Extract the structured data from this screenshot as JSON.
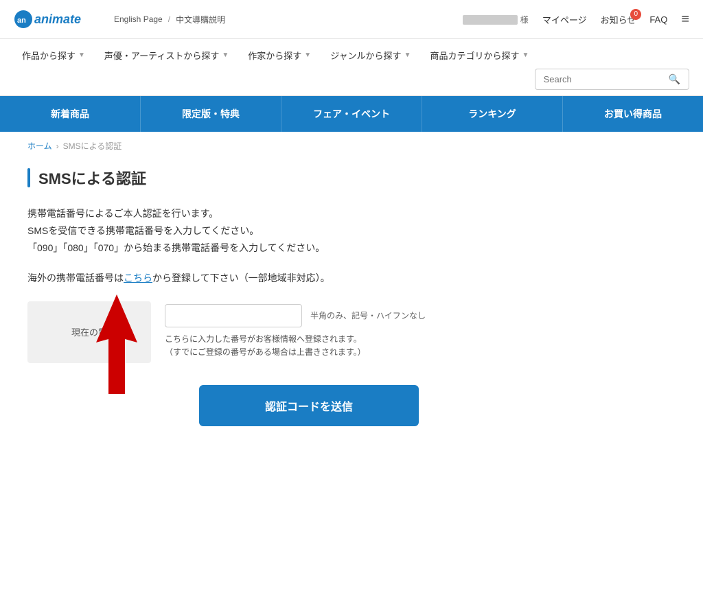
{
  "header": {
    "logo_alt": "animate",
    "english_page": "English Page",
    "separator": "/",
    "chinese_guide": "中文導購説明",
    "username": "様",
    "mypage": "マイページ",
    "notice": "お知らせ",
    "notice_count": "0",
    "faq": "FAQ",
    "menu_icon": "≡"
  },
  "nav": {
    "items": [
      {
        "label": "作品から探す",
        "has_dropdown": true
      },
      {
        "label": "声優・アーティストから探す",
        "has_dropdown": true
      },
      {
        "label": "作家から探す",
        "has_dropdown": true
      },
      {
        "label": "ジャンルから探す",
        "has_dropdown": true
      },
      {
        "label": "商品カテゴリから探す",
        "has_dropdown": true
      }
    ],
    "search_placeholder": "Search"
  },
  "tabs": [
    {
      "label": "新着商品"
    },
    {
      "label": "限定版・特典"
    },
    {
      "label": "フェア・イベント"
    },
    {
      "label": "ランキング"
    },
    {
      "label": "お買い得商品"
    }
  ],
  "breadcrumb": {
    "home": "ホーム",
    "current": "SMSによる認証"
  },
  "page": {
    "title": "SMSによる認証",
    "description_line1": "携帯電話番号によるご本人認証を行います。",
    "description_line2": "SMSを受信できる携帯電話番号を入力してください。",
    "description_line3": "「090」「080」「070」から始まる携帯電話番号を入力してください。",
    "overseas_prefix": "海外の携帯電話番号は",
    "overseas_link": "こちら",
    "overseas_suffix": "から登録して下さい（一部地域非対応）。",
    "current_phone_label": "現在の電",
    "phone_hint": "半角のみ、記号・ハイフンなし",
    "phone_note_line1": "こちらに入力した番号がお客様情報へ登録されます。",
    "phone_note_line2": "（すでにご登録の番号がある場合は上書きされます。）",
    "submit_label": "認証コードを送信"
  }
}
